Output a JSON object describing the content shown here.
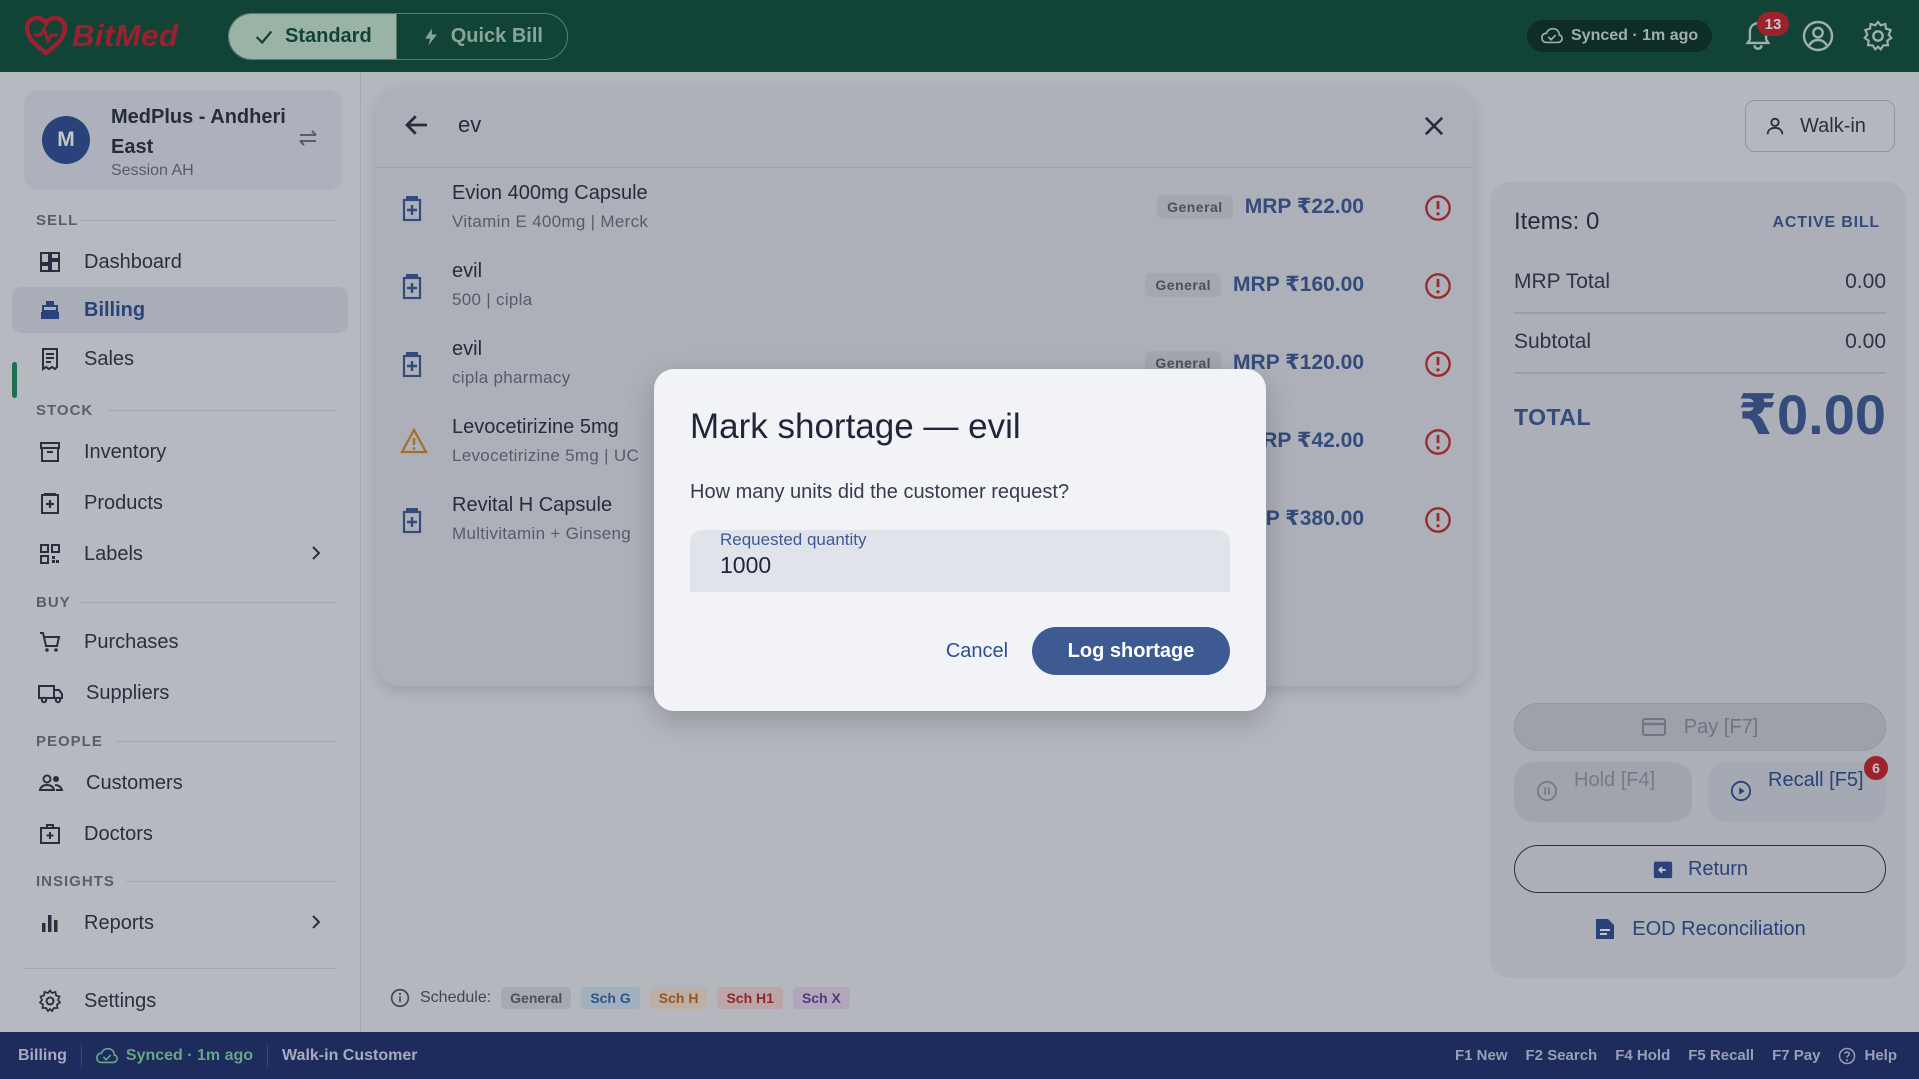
{
  "header": {
    "brand": "BitMed",
    "modes": [
      {
        "label": "Standard",
        "active": true
      },
      {
        "label": "Quick Bill",
        "active": false
      }
    ],
    "sync_status": "Synced · 1m ago",
    "notification_count": "13",
    "brand_color": "#0e4f3b"
  },
  "sidebar": {
    "store": {
      "avatar_letter": "M",
      "name": "MedPlus - Andheri East",
      "session": "Session AH"
    },
    "sections": {
      "sell": "SELL",
      "stock": "STOCK",
      "buy": "BUY",
      "people": "PEOPLE",
      "insights": "INSIGHTS"
    },
    "items": {
      "dashboard": "Dashboard",
      "billing": "Billing",
      "sales": "Sales",
      "inventory": "Inventory",
      "products": "Products",
      "labels": "Labels",
      "purchases": "Purchases",
      "suppliers": "Suppliers",
      "customers": "Customers",
      "doctors": "Doctors",
      "reports": "Reports",
      "settings": "Settings"
    }
  },
  "search": {
    "query": "ev",
    "results": [
      {
        "name": "Evion 400mg Capsule",
        "sub": "Vitamin E 400mg | Merck",
        "schedule": "General",
        "mrp": "MRP ₹22.00",
        "icon": "medicine-icon"
      },
      {
        "name": "evil",
        "sub": "500 | cipla",
        "schedule": "General",
        "mrp": "MRP ₹160.00",
        "icon": "medicine-icon"
      },
      {
        "name": "evil",
        "sub": "cipla pharmacy",
        "schedule": "General",
        "mrp": "MRP ₹120.00",
        "icon": "medicine-icon"
      },
      {
        "name": "Levocetirizine 5mg",
        "sub": "Levocetirizine 5mg | UC",
        "schedule": "",
        "mrp": "RP ₹42.00",
        "icon": "warning-icon"
      },
      {
        "name": "Revital H Capsule",
        "sub": "Multivitamin + Ginseng",
        "schedule": "",
        "mrp": "P ₹380.00",
        "icon": "medicine-icon"
      }
    ]
  },
  "bill": {
    "walkin_label": "Walk-in",
    "items_label": "Items: 0",
    "active_label": "ACTIVE BILL",
    "mrp_total_label": "MRP Total",
    "mrp_total_value": "0.00",
    "subtotal_label": "Subtotal",
    "subtotal_value": "0.00",
    "total_label": "TOTAL",
    "total_value": "₹0.00",
    "pay_label": "Pay  [F7]",
    "hold_label": "Hold [F4]",
    "recall_label": "Recall [F5]",
    "recall_count": "6",
    "return_label": "Return",
    "eod_label": "EOD Reconciliation"
  },
  "schedule_legend": {
    "label": "Schedule:",
    "tags": [
      {
        "label": "General",
        "bg": "#d6d8de",
        "fg": "#5b6172"
      },
      {
        "label": "Sch G",
        "bg": "#cfe0f2",
        "fg": "#2f6aa8"
      },
      {
        "label": "Sch H",
        "bg": "#f3e0cf",
        "fg": "#c0661f"
      },
      {
        "label": "Sch H1",
        "bg": "#f1d3d3",
        "fg": "#b52a2a"
      },
      {
        "label": "Sch X",
        "bg": "#e2d6ee",
        "fg": "#6b3d96"
      }
    ]
  },
  "statusbar": {
    "page": "Billing",
    "sync": "Synced · 1m ago",
    "customer": "Walk-in Customer",
    "shortcuts": [
      "F1 New",
      "F2 Search",
      "F4 Hold",
      "F5 Recall",
      "F7 Pay",
      "Help"
    ]
  },
  "modal": {
    "title": "Mark shortage — evil",
    "question": "How many units did the customer request?",
    "field_label": "Requested quantity",
    "field_value": "1000",
    "cancel_label": "Cancel",
    "confirm_label": "Log shortage"
  }
}
